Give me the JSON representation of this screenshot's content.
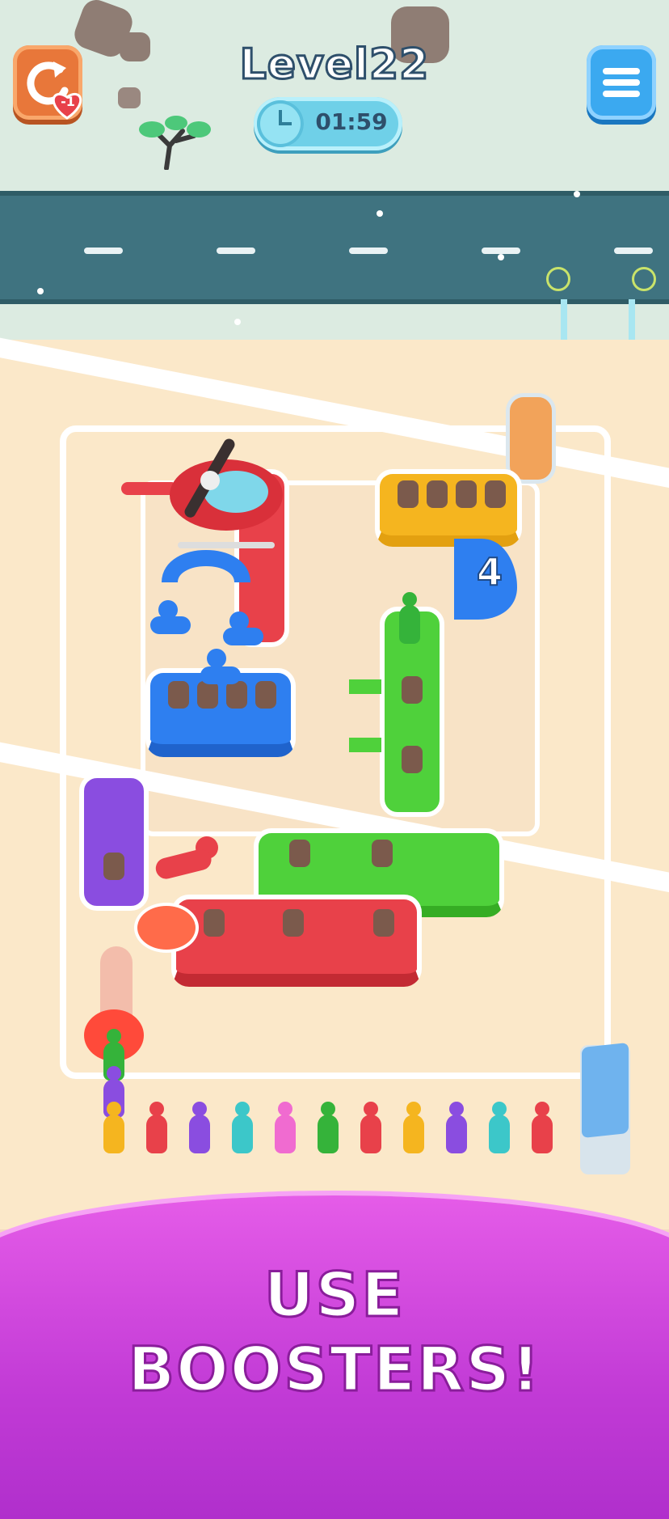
{
  "hud": {
    "level_label": "Level22",
    "timer": "01:59",
    "lives_delta": "-1",
    "restart_icon": "restart-icon",
    "menu_icon": "hamburger-menu-icon"
  },
  "board": {
    "capacity_badge": "4"
  },
  "banner": {
    "line1": "USE",
    "line2": "BOOSTERS!"
  },
  "colors": {
    "road": "#3f7380",
    "banner": "#c23bd6",
    "red": "#e8414a",
    "blue": "#2e7ff0",
    "green": "#4fd13b",
    "yellow": "#f5b51f",
    "purple": "#8a4de0",
    "orange": "#f2a35a"
  },
  "queue": [
    "#f5b51f",
    "#e8414a",
    "#8a4de0",
    "#3cc7c9",
    "#f06bd0",
    "#35b33a",
    "#e8414a",
    "#f5b51f",
    "#8a4de0",
    "#3cc7c9",
    "#e8414a"
  ]
}
